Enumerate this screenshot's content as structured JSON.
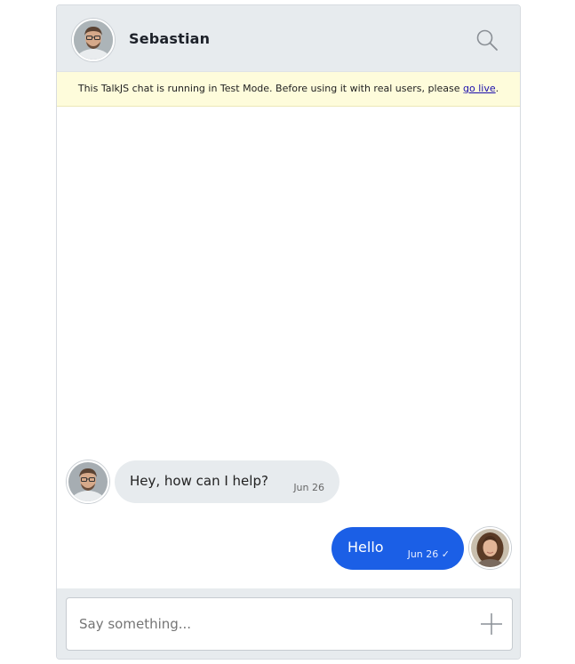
{
  "header": {
    "title": "Sebastian",
    "search_icon": "search-icon"
  },
  "banner": {
    "text": "This TalkJS chat is running in Test Mode. Before using it with real users, please ",
    "link_label": "go live",
    "suffix": "."
  },
  "messages": [
    {
      "direction": "incoming",
      "sender": "Sebastian",
      "text": "Hey, how can I help?",
      "time": "Jun 26"
    },
    {
      "direction": "outgoing",
      "text": "Hello",
      "time": "Jun 26",
      "status_icon": "checkmark-icon",
      "status_glyph": "✓"
    }
  ],
  "composer": {
    "placeholder": "Say something...",
    "attach_icon": "plus-icon"
  },
  "colors": {
    "header_bg": "#e7ebee",
    "banner_bg": "#fefcdb",
    "outgoing_bubble": "#1b5fe6",
    "incoming_bubble": "#e7ebee",
    "link": "#1a0dab"
  }
}
